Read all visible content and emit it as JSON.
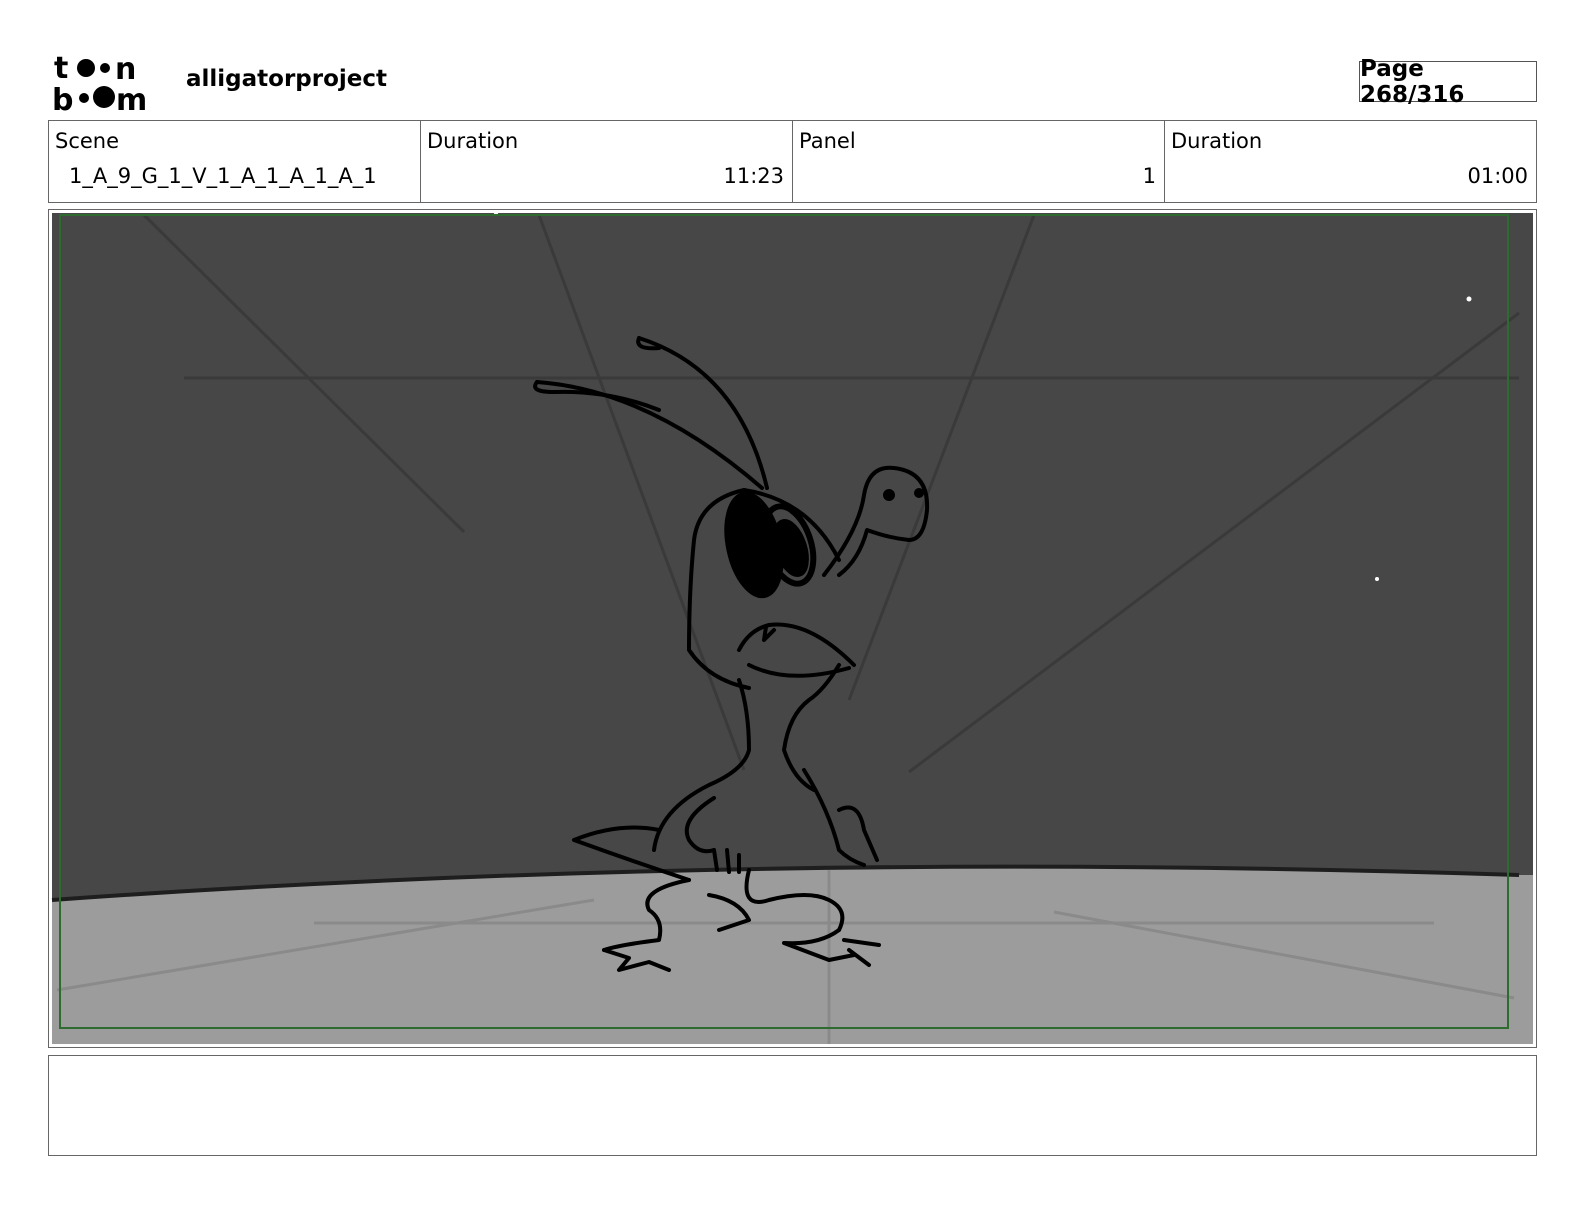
{
  "header": {
    "logo_text": "toon boom",
    "project_name": "alligatorproject",
    "page_label": "Page 268/316"
  },
  "info": {
    "scene_label": "Scene",
    "scene_value": "1_A_9_G_1_V_1_A_1_A_1_A_1",
    "scene_duration_label": "Duration",
    "scene_duration_value": "11:23",
    "panel_label": "Panel",
    "panel_value": "1",
    "panel_duration_label": "Duration",
    "panel_duration_value": "01:00"
  },
  "panel": {
    "sky_color": "#474747",
    "floor_color": "#9c9c9c",
    "safe_frame_color": "#2e6b2e",
    "ink_color": "#000000"
  },
  "notes": {
    "text": ""
  }
}
